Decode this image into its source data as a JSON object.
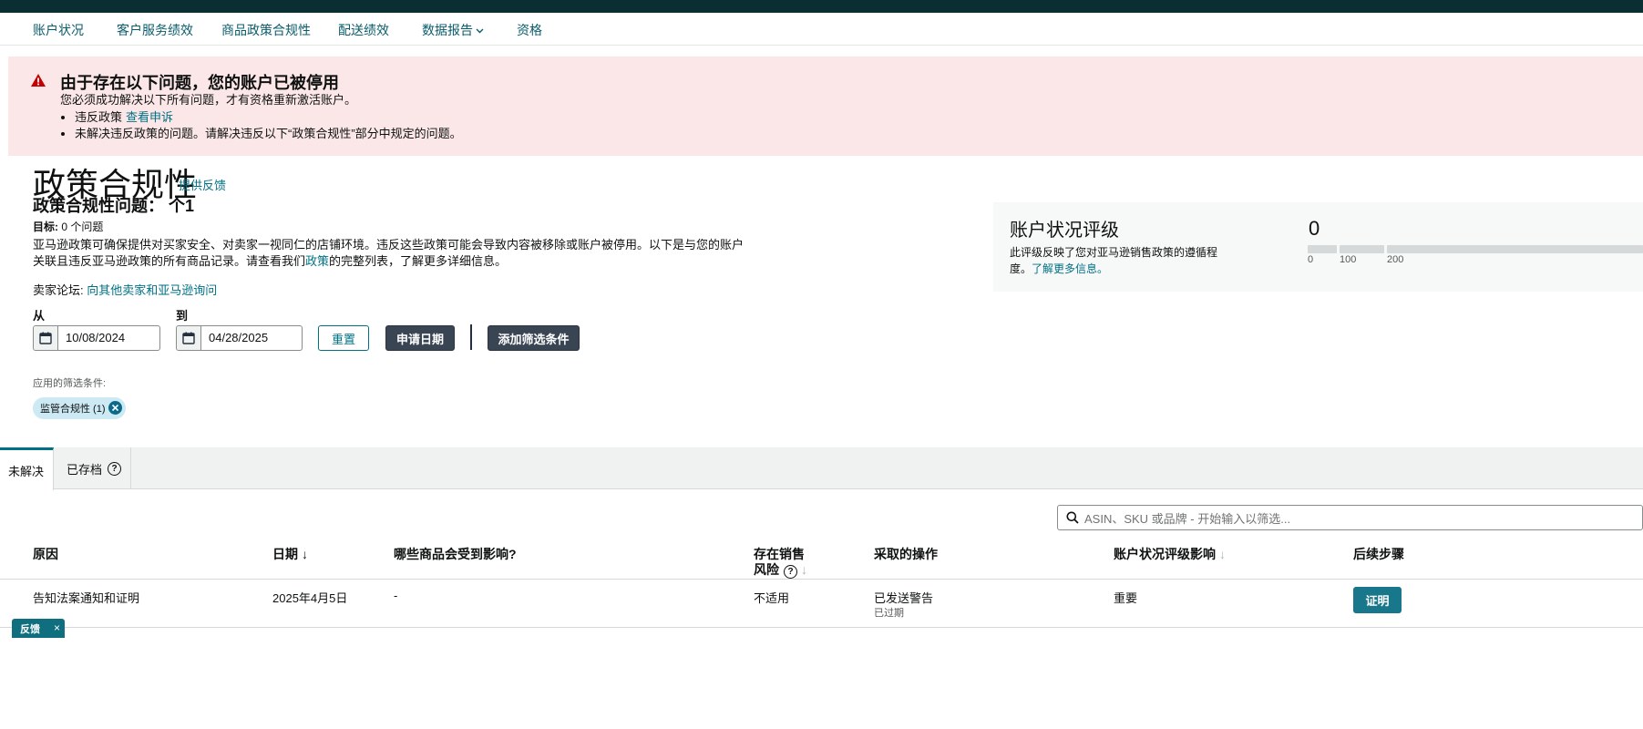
{
  "nav": {
    "items": [
      "账户状况",
      "客户服务绩效",
      "商品政策合规性",
      "配送绩效",
      "数据报告",
      "资格"
    ]
  },
  "alert": {
    "title": "由于存在以下问题，您的账户已被停用",
    "subtitle": "您必须成功解决以下所有问题，才有资格重新激活账户。",
    "item1_text": "违反政策",
    "item1_link": "查看申诉",
    "item2_text": "未解决违反政策的问题。请解决违反以下“政策合规性”部分中规定的问题。"
  },
  "page": {
    "title": "政策合规性",
    "feedback_link": "提供反馈",
    "issues_label": "政策合规性问题： 个1",
    "target_label": "目标:",
    "target_value": " 0 个问题",
    "description_a": "亚马逊政策可确保提供对买家安全、对卖家一视同仁的店铺环境。违反这些政策可能会导致内容被移除或账户被停用。以下是与您的账户关联且违反亚马逊政策的所有商品记录。请查看我们",
    "description_link": "政策",
    "description_b": "的完整列表，了解更多详细信息。",
    "forum_label": "卖家论坛:",
    "forum_link": "向其他卖家和亚马逊询问"
  },
  "filters": {
    "from_label": "从",
    "to_label": "到",
    "from_date": "10/08/2024",
    "to_date": "04/28/2025",
    "reset": "重置",
    "apply_date": "申请日期",
    "add_filter": "添加筛选条件",
    "applied_label": "应用的筛选条件:",
    "chip": "监管合规性 (1)"
  },
  "status_card": {
    "title": "账户状况评级",
    "desc_text": "此评级反映了您对亚马逊销售政策的遵循程度。",
    "desc_link": "了解更多信息。",
    "score": "0",
    "ticks": [
      "0",
      "100",
      "200"
    ]
  },
  "tabs": {
    "open": "未解决",
    "archived": "已存档",
    "help_glyph": "?"
  },
  "search": {
    "placeholder": "ASIN、SKU 或品牌 - 开始输入以筛选..."
  },
  "table": {
    "headers": {
      "reason": "原因",
      "date": "日期",
      "affected": "哪些商品会受到影响?",
      "risk_line1": "存在销售",
      "risk_line2": "风险",
      "action": "采取的操作",
      "impact": "账户状况评级影响",
      "next": "后续步骤"
    },
    "rows": [
      {
        "reason": "告知法案通知和证明",
        "date": "2025年4月5日",
        "affected": "-",
        "risk": "不适用",
        "action": "已发送警告",
        "action_sub": "已过期",
        "impact": "重要",
        "next": "证明"
      }
    ]
  },
  "feedback_tab": {
    "label": "反馈",
    "close": "×"
  }
}
